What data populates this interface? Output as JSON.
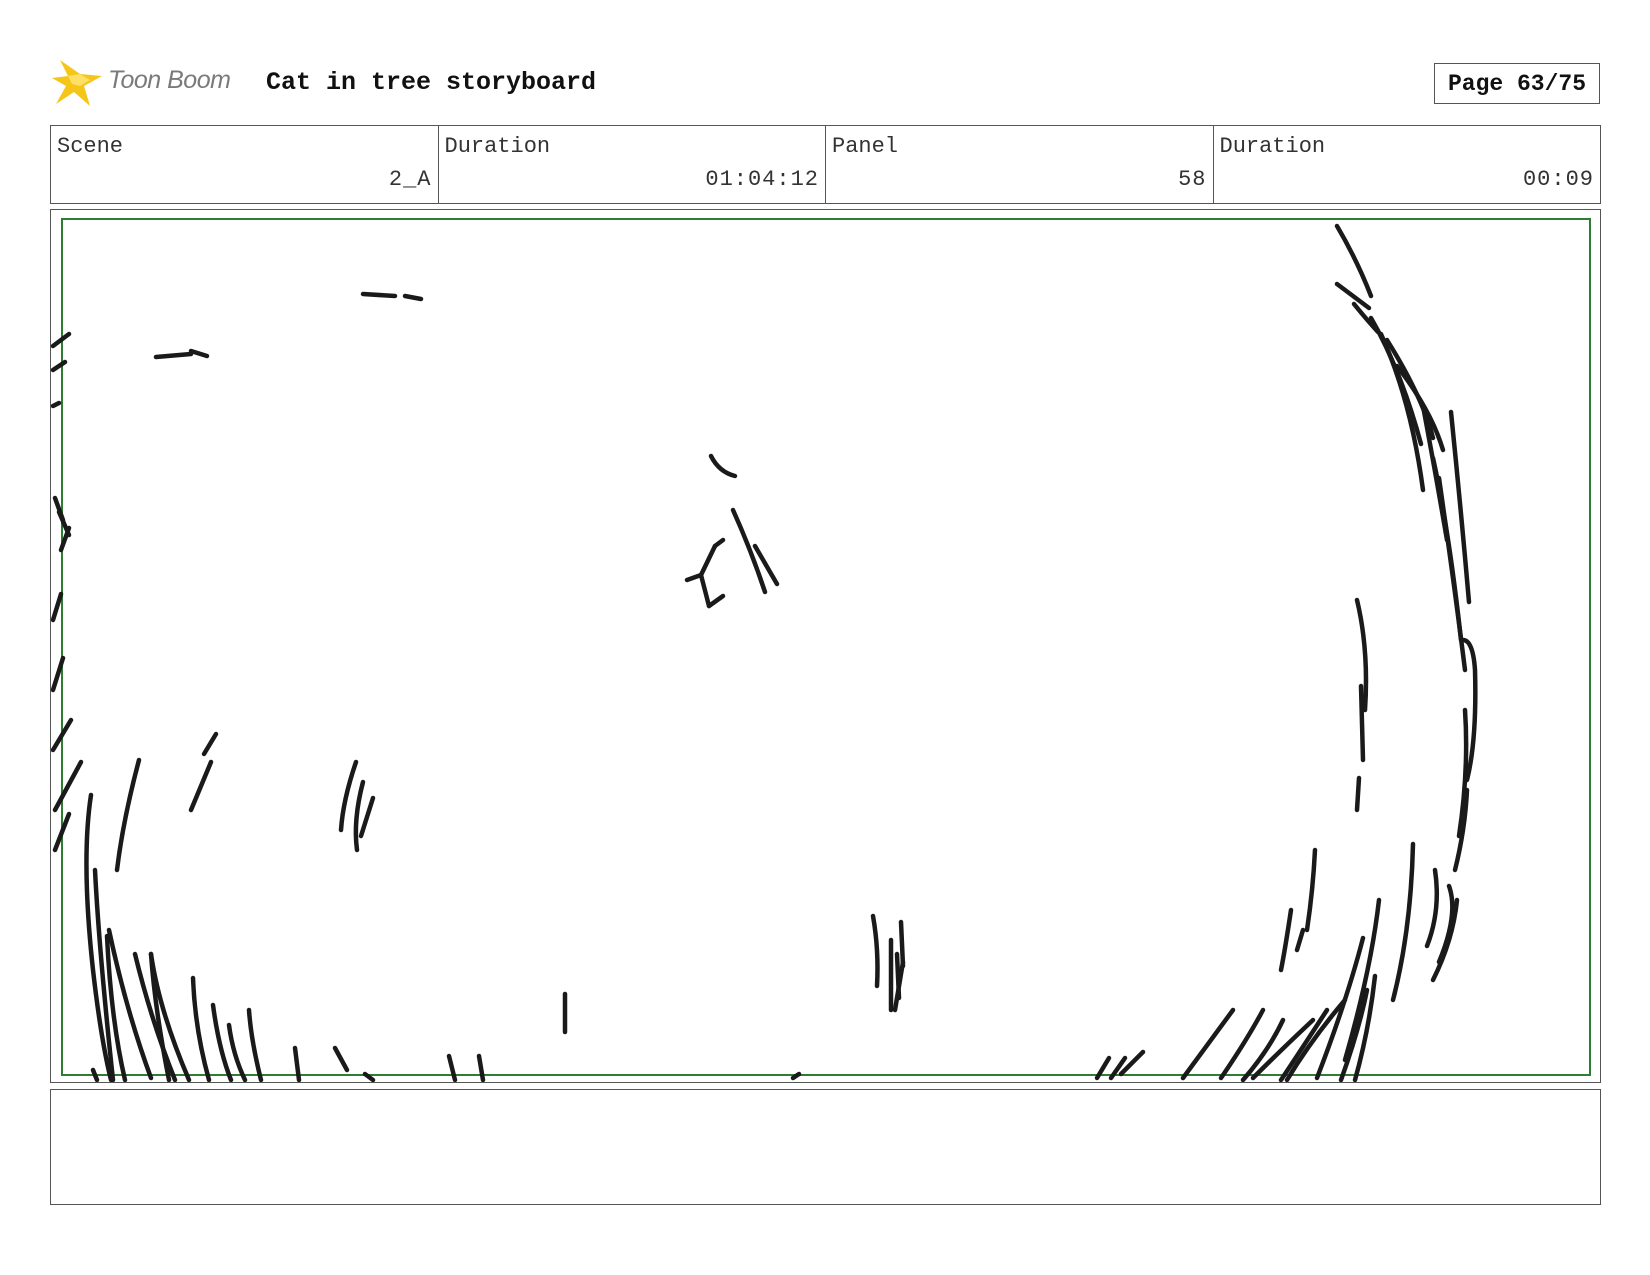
{
  "header": {
    "logo_text": "Toon Boom",
    "title": "Cat in tree storyboard",
    "page_label": "Page 63/75"
  },
  "info": {
    "scene_label": "Scene",
    "scene_value": "2_A",
    "scene_duration_label": "Duration",
    "scene_duration_value": "01:04:12",
    "panel_label": "Panel",
    "panel_value": "58",
    "panel_duration_label": "Duration",
    "panel_duration_value": "00:09"
  },
  "colors": {
    "logo_star": "#f5c518",
    "safe_frame": "#2e7d32",
    "sketch": "#1a1a1a"
  },
  "notes": {
    "text": ""
  }
}
